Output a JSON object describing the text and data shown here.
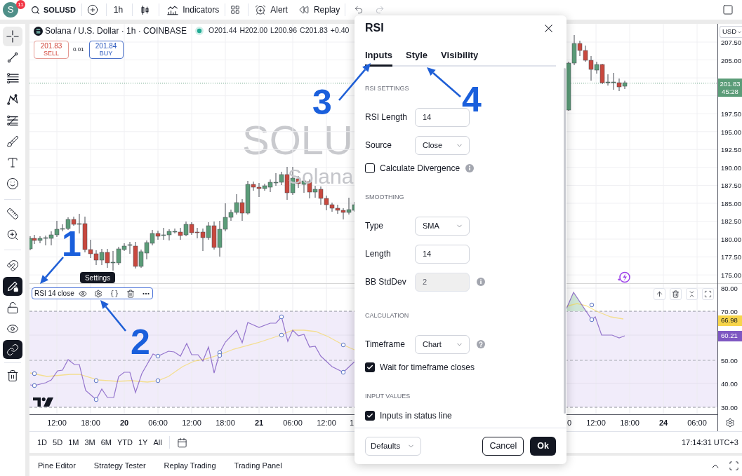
{
  "top_bar": {
    "avatar": "S",
    "notifications": "11",
    "symbol": "SOLUSD",
    "interval": "1h",
    "indicators": "Indicators",
    "alert": "Alert",
    "replay": "Replay"
  },
  "drawing_toolbar": {
    "tools": [
      {
        "selected": true
      },
      {
        "selected": false
      },
      {
        "selected": false
      },
      {
        "selected": false
      },
      {
        "selected": false
      },
      {
        "selected": false
      },
      {
        "selected": false
      },
      {
        "selected": false
      }
    ],
    "measure_tools": [
      {
        "selected": false
      },
      {
        "selected": false
      }
    ],
    "toggles": [
      {
        "on": false
      },
      {
        "on": true
      },
      {
        "on": false
      },
      {
        "on": false
      },
      {
        "on": true
      }
    ]
  },
  "chart": {
    "legend": {
      "symbol": "Solana / U.S. Dollar · 1h · COINBASE",
      "ohlc": [
        "O201.44",
        "H202.00",
        "L200.96",
        "C201.83",
        "+0.40"
      ]
    },
    "trade": {
      "sell_price": "201.83",
      "sell_label": "SELL",
      "spread": "0.01",
      "buy_price": "201.84",
      "buy_label": "BUY"
    },
    "watermark": {
      "ticker": "SOLU",
      "name": "Solana"
    },
    "price_axis": {
      "currency": "USD",
      "upper_labels": [
        "207.50",
        "205.00"
      ],
      "last_price": "201.83",
      "countdown": "45:28",
      "lower_labels": [
        "197.50",
        "195.00",
        "192.50",
        "190.00",
        "187.50",
        "185.00",
        "182.50",
        "180.00",
        "177.50",
        "175.00"
      ]
    },
    "indicator": {
      "legend": "RSI 14 close",
      "tooltip": "Settings",
      "upper_labels": [
        "80.00",
        "70.00"
      ],
      "values": [
        {
          "text": "66.98",
          "color": "#f7d54a"
        },
        {
          "text": "60.21",
          "color": "#7e57c2"
        }
      ],
      "lower_labels": [
        "50.00",
        "40.00",
        "30.00"
      ]
    },
    "time_axis": {
      "left_labels": [
        {
          "text": "12:00",
          "kind": "time"
        },
        {
          "text": "18:00",
          "kind": "time"
        },
        {
          "text": "20",
          "kind": "day"
        },
        {
          "text": "06:00",
          "kind": "time"
        },
        {
          "text": "12:00",
          "kind": "time"
        },
        {
          "text": "18:00",
          "kind": "time"
        },
        {
          "text": "21",
          "kind": "day"
        },
        {
          "text": "06:00",
          "kind": "time"
        },
        {
          "text": "12:00",
          "kind": "time"
        },
        {
          "text": "1",
          "kind": "time"
        }
      ],
      "right_labels": [
        {
          "text": "0",
          "kind": "time"
        },
        {
          "text": "12:00",
          "kind": "time"
        },
        {
          "text": "18:00",
          "kind": "time"
        },
        {
          "text": "24",
          "kind": "day"
        },
        {
          "text": "06:00",
          "kind": "time"
        }
      ]
    }
  },
  "range_bar": {
    "ranges": [
      {
        "label": "1D",
        "selected": false
      },
      {
        "label": "5D",
        "selected": false
      },
      {
        "label": "1M",
        "selected": false
      },
      {
        "label": "3M",
        "selected": false
      },
      {
        "label": "6M",
        "selected": false
      },
      {
        "label": "YTD",
        "selected": false
      },
      {
        "label": "1Y",
        "selected": false
      },
      {
        "label": "All",
        "selected": false
      }
    ],
    "clock": "17:14:31 UTC+3"
  },
  "bottom_panel": {
    "tabs": [
      {
        "label": "Pine Editor",
        "selected": false
      },
      {
        "label": "Strategy Tester",
        "selected": false
      },
      {
        "label": "Replay Trading",
        "selected": false
      },
      {
        "label": "Trading Panel",
        "selected": false
      }
    ]
  },
  "dialog": {
    "title": "RSI",
    "tabs": [
      {
        "label": "Inputs",
        "selected": true
      },
      {
        "label": "Style",
        "selected": false
      },
      {
        "label": "Visibility",
        "selected": false
      }
    ],
    "sections": [
      {
        "heading": "RSI SETTINGS",
        "fields": [
          {
            "kind": "input",
            "label": "RSI Length",
            "value": "14",
            "disabled": false
          },
          {
            "kind": "select",
            "label": "Source",
            "value": "Close",
            "disabled": false
          },
          {
            "kind": "checkbox",
            "label": "Calculate Divergence",
            "checked": false,
            "disabled": false,
            "info": true
          }
        ]
      },
      {
        "heading": "SMOOTHING",
        "fields": [
          {
            "kind": "select",
            "label": "Type",
            "value": "SMA",
            "disabled": false
          },
          {
            "kind": "input",
            "label": "Length",
            "value": "14",
            "disabled": false
          },
          {
            "kind": "input",
            "label": "BB StdDev",
            "value": "2",
            "disabled": true,
            "info": true
          }
        ]
      },
      {
        "heading": "CALCULATION",
        "fields": [
          {
            "kind": "select",
            "label": "Timeframe",
            "value": "Chart",
            "disabled": false,
            "help": true
          },
          {
            "kind": "checkbox",
            "label": "Wait for timeframe closes",
            "checked": true,
            "disabled": false
          }
        ]
      },
      {
        "heading": "INPUT VALUES",
        "fields": [
          {
            "kind": "checkbox",
            "label": "Inputs in status line",
            "checked": true,
            "disabled": false
          }
        ]
      }
    ],
    "footer": {
      "defaults": "Defaults",
      "cancel": "Cancel",
      "ok": "Ok"
    }
  },
  "annotations": [
    "1",
    "2",
    "3",
    "4"
  ]
}
